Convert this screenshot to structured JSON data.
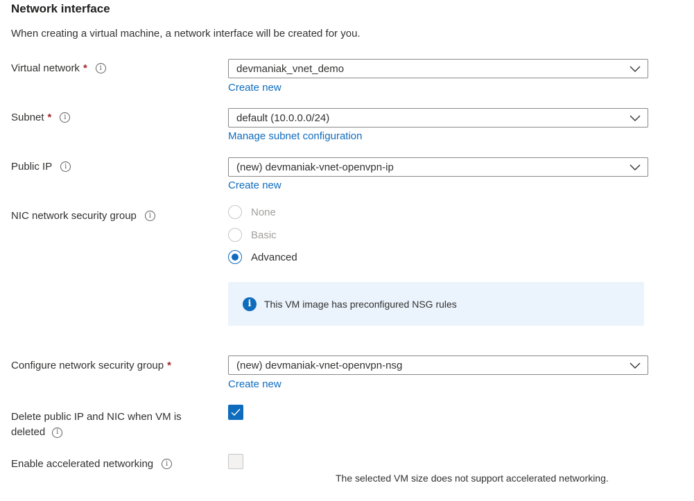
{
  "section": {
    "title": "Network interface",
    "description": "When creating a virtual machine, a network interface will be created for you."
  },
  "virtual_network": {
    "label": "Virtual network",
    "required": "*",
    "value": "devmaniak_vnet_demo",
    "link": "Create new"
  },
  "subnet": {
    "label": "Subnet",
    "required": "*",
    "value": "default (10.0.0.0/24)",
    "link": "Manage subnet configuration"
  },
  "public_ip": {
    "label": "Public IP",
    "value": "(new) devmaniak-vnet-openvpn-ip",
    "link": "Create new"
  },
  "nic_nsg": {
    "label": "NIC network security group",
    "options": [
      "None",
      "Basic",
      "Advanced"
    ],
    "selected": "Advanced",
    "info_message": "This VM image has preconfigured NSG rules"
  },
  "configure_nsg": {
    "label": "Configure network security group",
    "required": "*",
    "value": "(new) devmaniak-vnet-openvpn-nsg",
    "link": "Create new"
  },
  "delete_public_ip": {
    "label_line1": "Delete public IP and NIC when VM is",
    "label_line2": "deleted",
    "checked": true
  },
  "accelerated_networking": {
    "label": "Enable accelerated networking",
    "checked": false,
    "note": "The selected VM size does not support accelerated networking."
  },
  "colors": {
    "accent": "#0f6cbd",
    "required": "#a4262c",
    "info_background": "#ebf3fc"
  },
  "icons": {
    "info": "info-circle-icon",
    "dropdown": "chevron-down-icon",
    "info_filled": "info-filled-icon",
    "check": "checkmark-icon"
  }
}
